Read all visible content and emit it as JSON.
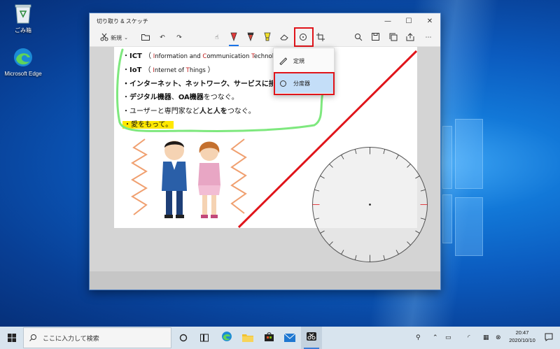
{
  "desktop": {
    "icons": [
      {
        "label": "ごみ箱",
        "icon": "recycle-bin-icon"
      },
      {
        "label": "Microsoft Edge",
        "icon": "edge-icon"
      }
    ]
  },
  "window": {
    "title": "切り取り & スケッチ",
    "controls": {
      "minimize": "—",
      "maximize": "☐",
      "close": "✕"
    },
    "toolbar": {
      "new_label": "新規",
      "active_tool": "protractor"
    },
    "document_lines": [
      {
        "prefix": "・",
        "bold": "ICT",
        "rest_open": "（",
        "words": [
          {
            "cap": "I",
            "tail": "nformation and "
          },
          {
            "cap": "C",
            "tail": "ommunication "
          },
          {
            "cap": "T",
            "tail": "echnolog"
          }
        ]
      },
      {
        "prefix": "・",
        "bold": "IoT",
        "rest_open": "（",
        "words": [
          {
            "cap": "I",
            "tail": "nternet of "
          },
          {
            "cap": "T",
            "tail": "hings"
          }
        ],
        "close": "）"
      },
      {
        "text": "・インターネット、ネットワーク、サービスに接"
      },
      {
        "pre": "・",
        "bold1": "デジタル機器",
        "mid": "、",
        "bold2": "OA機器",
        "post": "をつなぐ。"
      },
      {
        "pre": "・ユーザーと専門家など",
        "bold1": "人と人を",
        "post": "つなぐ。"
      },
      {
        "text": "・愛をもって。"
      }
    ],
    "dropdown": {
      "items": [
        {
          "label": "定規",
          "icon": "ruler-icon"
        },
        {
          "label": "分度器",
          "icon": "protractor-icon",
          "selected": true
        }
      ]
    }
  },
  "taskbar": {
    "search_placeholder": "ここに入力して検索",
    "clock_time": "20:47",
    "clock_date": "2020/10/10"
  },
  "colors": {
    "highlight_box": "#e0141a",
    "red_line": "#e0141a",
    "green_loop": "#7ee87e",
    "marker_yellow": "#ffe800",
    "selection": "#c4def8"
  }
}
